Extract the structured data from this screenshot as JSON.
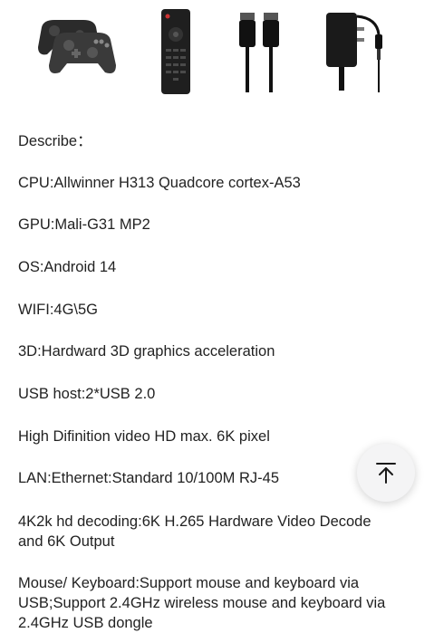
{
  "accessories": {
    "items": [
      {
        "name": "gamepad-pair",
        "icon": "gamepad-icon"
      },
      {
        "name": "remote-control",
        "icon": "remote-icon"
      },
      {
        "name": "hdmi-cable",
        "icon": "hdmi-cable-icon"
      },
      {
        "name": "power-adapter",
        "icon": "power-adapter-icon"
      }
    ]
  },
  "specs": {
    "describe": "Describe：",
    "cpu": "CPU:Allwinner H313 Quadcore cortex-A53",
    "gpu": "GPU:Mali-G31 MP2",
    "os": "OS:Android 14",
    "wifi": "WIFI:4G\\5G",
    "graphics": "3D:Hardward 3D graphics acceleration",
    "usb": "USB host:2*USB 2.0",
    "video": "High Difinition video HD max. 6K pixel",
    "lan": "LAN:Ethernet:Standard 10/100M  RJ-45",
    "decoding_line1": "4K2k hd decoding:6K H.265 Hardware Video Decode",
    "decoding_line2": "and 6K Output",
    "mouse_line1": "Mouse/ Keyboard:Support mouse and keyboard via",
    "mouse_line2": "USB;Support 2.4GHz wireless mouse and keyboard via",
    "mouse_line3": "2.4GHz USB dongle"
  },
  "scroll_top": {
    "icon": "arrow-up-to-top-icon"
  },
  "colors": {
    "text": "#222222",
    "button_bg": "#f4f4f5",
    "icon": "#1a1a1a"
  }
}
